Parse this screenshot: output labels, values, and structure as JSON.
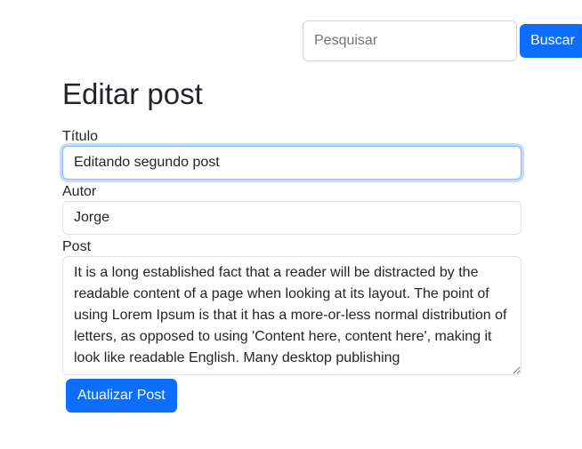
{
  "search": {
    "placeholder": "Pesquisar",
    "value": "",
    "button_label": "Buscar"
  },
  "form": {
    "title": "Editar post",
    "fields": {
      "titulo": {
        "label": "Título",
        "value": "Editando segundo post"
      },
      "autor": {
        "label": "Autor",
        "value": "Jorge"
      },
      "post": {
        "label": "Post",
        "value": "It is a long established fact that a reader will be distracted by the readable content of a page when looking at its layout. The point of using Lorem Ipsum is that it has a more-or-less normal distribution of letters, as opposed to using 'Content here, content here', making it look like readable English. Many desktop publishing"
      }
    },
    "submit_label": "Atualizar Post"
  },
  "colors": {
    "primary": "#0d6efd",
    "focus_ring": "#86b7fe",
    "text": "#212529",
    "border": "#dee2e6"
  }
}
